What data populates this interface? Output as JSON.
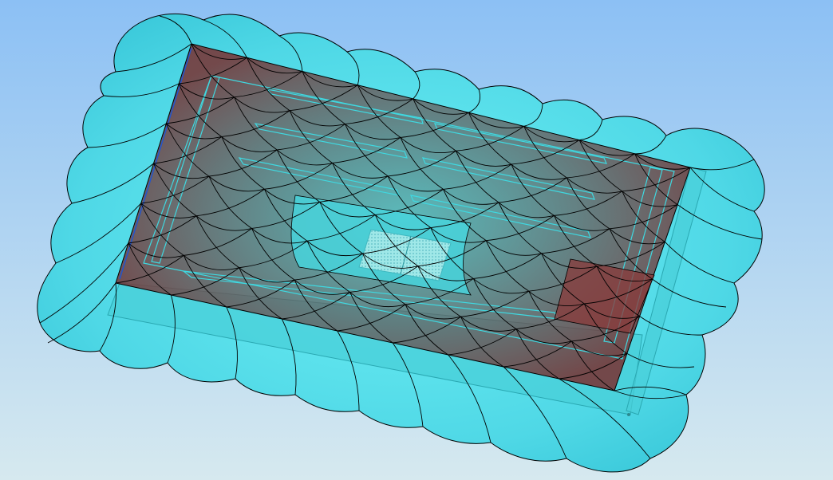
{
  "viewport": {
    "background_top": "#8cc0f4",
    "background_bottom": "#d6e9ef"
  },
  "model": {
    "surface_color": "#5fe6ee",
    "surface_edge_color": "#000000",
    "inner_tint": "#8a3a3a",
    "guide_color": "#3fd8e0",
    "highlight_edge_color": "#2255cc"
  }
}
